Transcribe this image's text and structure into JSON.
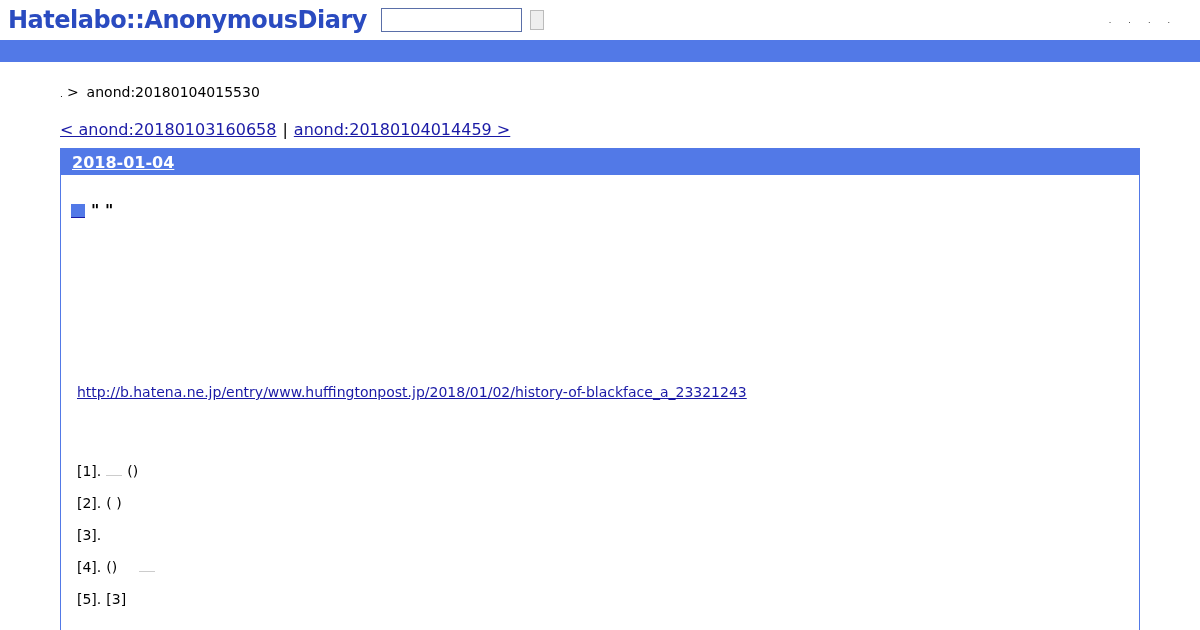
{
  "header": {
    "logo": "Hatelabo::AnonymousDiary",
    "links": [
      ".",
      ".",
      ".",
      "."
    ]
  },
  "breadcrumb": {
    "home": ".",
    "separator": ">",
    "current": "anond:20180104015530"
  },
  "pager": {
    "prev": "< anond:20180103160658",
    "separator": "|",
    "next": "anond:20180104014459 >"
  },
  "day": {
    "date": "2018-01-04",
    "section_title": "\"  \"",
    "link": "http://b.hatena.ne.jp/entry/www.huffingtonpost.jp/2018/01/02/history-of-blackface_a_23321243",
    "items": [
      {
        "text": "[1].",
        "rest": "()",
        "link_before": true,
        "link_after": false
      },
      {
        "text": "[2].",
        "rest": "(      )",
        "link_before": false,
        "link_after": false
      },
      {
        "text": "[3].",
        "link_before": false,
        "link_after": false
      },
      {
        "text": "[4].",
        "rest": "()",
        "link_before": false,
        "link_after": true
      },
      {
        "text": "[5].",
        "rest": "[3]",
        "link_before": false,
        "link_after": false
      }
    ]
  }
}
